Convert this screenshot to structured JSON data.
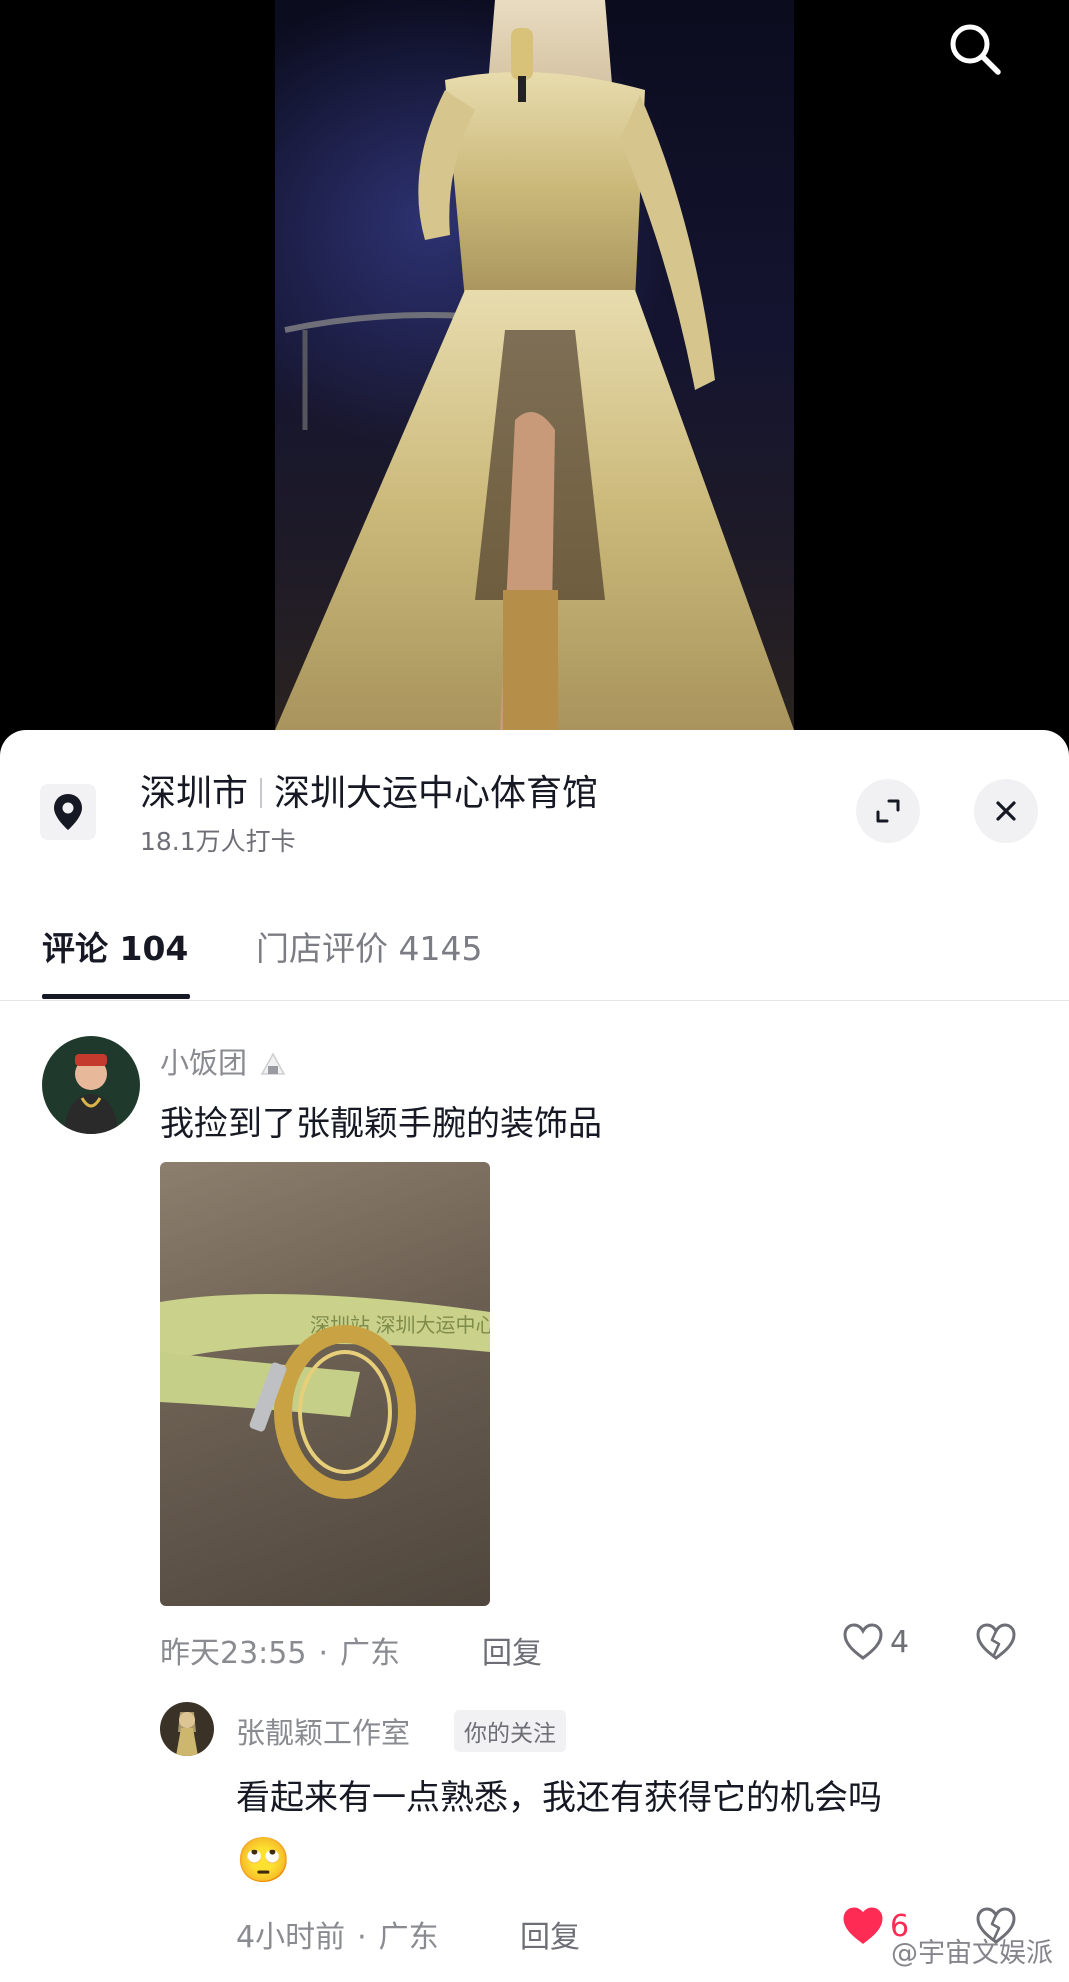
{
  "location": {
    "city": "深圳市",
    "venue": "深圳大运中心体育馆",
    "checkins": "18.1万人打卡"
  },
  "tabs": [
    {
      "label": "评论 104",
      "active": true
    },
    {
      "label": "门店评价 4145",
      "active": false
    }
  ],
  "comments": [
    {
      "username": "小饭团",
      "text": "我捡到了张靓颖手腕的装饰品",
      "photo_banner_text": "深圳站  深圳大运中心体育馆",
      "time": "昨天23:55",
      "region": "广东",
      "reply_label": "回复",
      "likes": "4",
      "liked": false,
      "replies": [
        {
          "username": "张靓颖工作室",
          "badge": "你的关注",
          "text": "看起来有一点熟悉，我还有获得它的机会吗",
          "emoji": "🙄",
          "time": "4小时前",
          "region": "广东",
          "reply_label": "回复",
          "likes": "6",
          "liked": true
        }
      ]
    }
  ],
  "watermark": "@宇宙文娱派",
  "icons": {
    "search": "search-icon",
    "location": "location-pin-icon",
    "expand": "expand-icon",
    "close": "close-icon",
    "like": "heart-icon",
    "dislike": "broken-heart-icon"
  },
  "colors": {
    "accent_like": "#fe2c55",
    "text_primary": "#161823",
    "text_secondary": "#8a8b91"
  }
}
